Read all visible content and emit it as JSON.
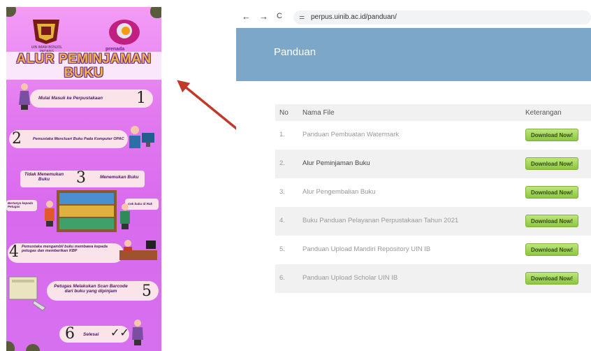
{
  "poster": {
    "logo_left_caption": "UIN IMAM BONJOL PADANG",
    "logo_right_brand": "prenada",
    "title_line1": "ALUR PEMINJAMAN",
    "title_line2": "BUKU",
    "steps": [
      {
        "number": "1",
        "text": "Mulai Masuk ke Perpustakaan"
      },
      {
        "number": "2",
        "text": "Pemustaka Mencluari Buku Pada Komputer OPAC"
      },
      {
        "number": "3",
        "text": ""
      },
      {
        "number": "4",
        "text": "Pemustaka mengambil buku membawa kepada petugas dan memberikan KBP"
      },
      {
        "number": "5",
        "text": "Petugas Melakukan Scan Barcode dari buku yang dipinjam"
      },
      {
        "number": "6",
        "text": "Selesai"
      }
    ],
    "branch_left_title": "Tidak Menemukan Buku",
    "branch_right_title": "Menemukan Buku",
    "branch_left_note": "Bertanya kepada Petugas",
    "branch_right_note": "Cek buku di Rak",
    "check_mark": "✓✓"
  },
  "browser": {
    "url": "perpus.uinib.ac.id/panduan/",
    "back_icon": "←",
    "forward_icon": "→",
    "reload_icon": "C",
    "tune_icon": "⚌",
    "page_title": "Panduan",
    "table_headers": {
      "no": "No",
      "name": "Nama File",
      "info": "Keterangan"
    },
    "rows": [
      {
        "no": "1.",
        "name": "Panduan Pembuatan Watermark",
        "button": "Download Now!"
      },
      {
        "no": "2.",
        "name": "Alur Peminjaman Buku",
        "button": "Download Now!"
      },
      {
        "no": "3.",
        "name": "Alur Pengembalian Buku",
        "button": "Download Now!"
      },
      {
        "no": "4.",
        "name": "Buku Panduan Pelayanan Perpustakaan Tahun 2021",
        "button": "Download Now!"
      },
      {
        "no": "5.",
        "name": "Panduan Upload Mandiri Repository UIN IB",
        "button": "Download Now!"
      },
      {
        "no": "6.",
        "name": "Panduan Upload Scholar UIN IB",
        "button": "Download Now!"
      }
    ]
  },
  "colors": {
    "banner": "#7ca7c8",
    "poster_bg": "#e37af0",
    "download_button": "#8dc63f",
    "arrow": "#c0392b"
  }
}
